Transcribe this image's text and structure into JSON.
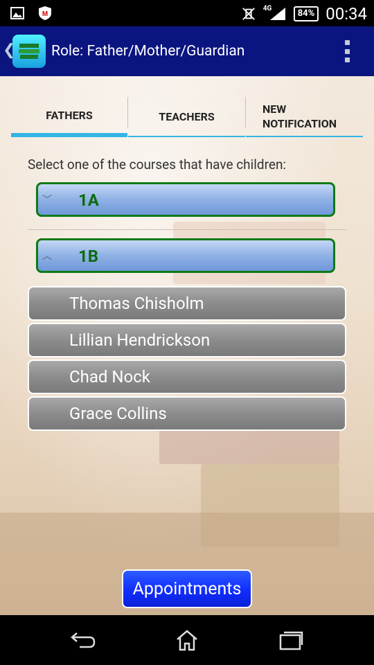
{
  "status_bar": {
    "icons": [
      "image-icon",
      "mcafee-icon",
      "vibrate-off-icon",
      "signal-4g-icon"
    ],
    "network": "4G",
    "battery": "84%",
    "time": "00:34"
  },
  "action_bar": {
    "title": "Role: Father/Mother/Guardian",
    "colors": {
      "background": "#0b1580"
    }
  },
  "tabs": [
    {
      "label": "FATHERS",
      "active": true
    },
    {
      "label": "TEACHERS",
      "active": false
    },
    {
      "label": "NEW NOTIFICATION",
      "active": false
    }
  ],
  "instruction": "Select one of the courses that have children:",
  "courses": [
    {
      "label": "1A",
      "expanded": false
    },
    {
      "label": "1B",
      "expanded": true
    }
  ],
  "children": [
    "Thomas Chisholm",
    "Lillian Hendrickson",
    "Chad Nock",
    "Grace Collins"
  ],
  "appointments_label": "Appointments",
  "nav_bar": {
    "icons": [
      "back-icon",
      "home-icon",
      "recent-apps-icon"
    ]
  },
  "colors": {
    "tab_indicator": "#33b5e5",
    "course_border": "#0e7a18",
    "course_text": "#0d6b12",
    "appointments": "#1230ff"
  }
}
